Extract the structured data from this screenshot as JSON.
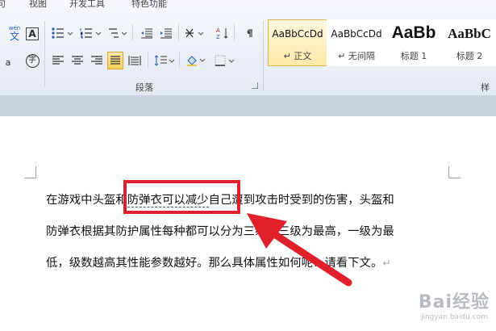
{
  "ribbon": {
    "tabs": [
      "视图",
      "开发工具",
      "特色功能"
    ],
    "groups": {
      "paragraph": "段落",
      "styles": "样式"
    },
    "styles": [
      {
        "sample": "AaBbCcDd",
        "name": "↵ 正文",
        "active": true
      },
      {
        "sample": "AaBbCcDd",
        "name": "↵ 无间隔",
        "active": false
      },
      {
        "sample": "AaBb",
        "name": "标题 1",
        "active": false
      },
      {
        "sample": "AaBbC",
        "name": "标题 2",
        "active": false
      }
    ],
    "font_buttons": {
      "phonetic": "文",
      "phonetic_top": "wén",
      "enclose": "字",
      "border": "A"
    }
  },
  "document": {
    "line1": {
      "before": "在游戏中头盔",
      "hidden_char": "和",
      "selected": "防弹衣可以减少",
      "after": "自己遭到攻击时受到的伤害，头盔和"
    },
    "line2": "防弹衣根据其防护属性每种都可以分为三级，三级为最高，一级为最",
    "line3": "低，级数越高其性能参数越好。那么具体属性如何呢？请看下文。",
    "paragraph_mark": "↵"
  },
  "colors": {
    "highlight": "#e0202a",
    "active_style_border": "#e2b34a"
  }
}
